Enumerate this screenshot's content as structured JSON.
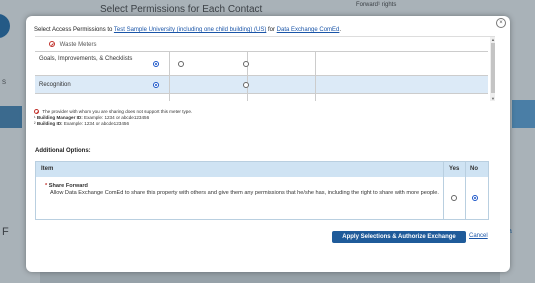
{
  "background": {
    "title": "Select Permissions for Each Contact",
    "right_text": "Forward¹ rights",
    "side_s": "S",
    "side_f": "F",
    "right_a": "a"
  },
  "modal": {
    "close_symbol": "×",
    "instruction_prefix": "Select Access Permissions to ",
    "property_link": "Test Sample University (including one child building) (US)",
    "instruction_mid": " for ",
    "company_link": "Data Exchange ComEd",
    "instruction_suffix": ".",
    "permissions_rows": [
      {
        "label": "Waste Meters",
        "icon": "no-entry-icon"
      },
      {
        "label": "Goals, Improvements, & Checklists",
        "selected": "col1"
      },
      {
        "label": "Recognition",
        "selected": "col1"
      }
    ],
    "notes": {
      "no_support": "The provider with whom you are sharing does not support this meter type.",
      "bm_label": "Building Manager ID:",
      "bm_prefix": "¹ ",
      "bm_example": " Example: 1234 or abcde123456",
      "bid_prefix": "² ",
      "bid_label": "Building ID:",
      "bid_example": " Example: 1234 or abcde123456"
    },
    "additional_options_title": "Additional Options:",
    "options_table": {
      "col_item": "Item",
      "col_yes": "Yes",
      "col_no": "No",
      "rows": [
        {
          "star": "*",
          "title": "Share Forward",
          "description": "Allow Data Exchange ComEd to share this property with others and give them any permissions that he/she has, including the right to share with more people.",
          "selected": "no"
        }
      ]
    },
    "apply_button": "Apply Selections & Authorize Exchange",
    "cancel_link": "Cancel"
  }
}
